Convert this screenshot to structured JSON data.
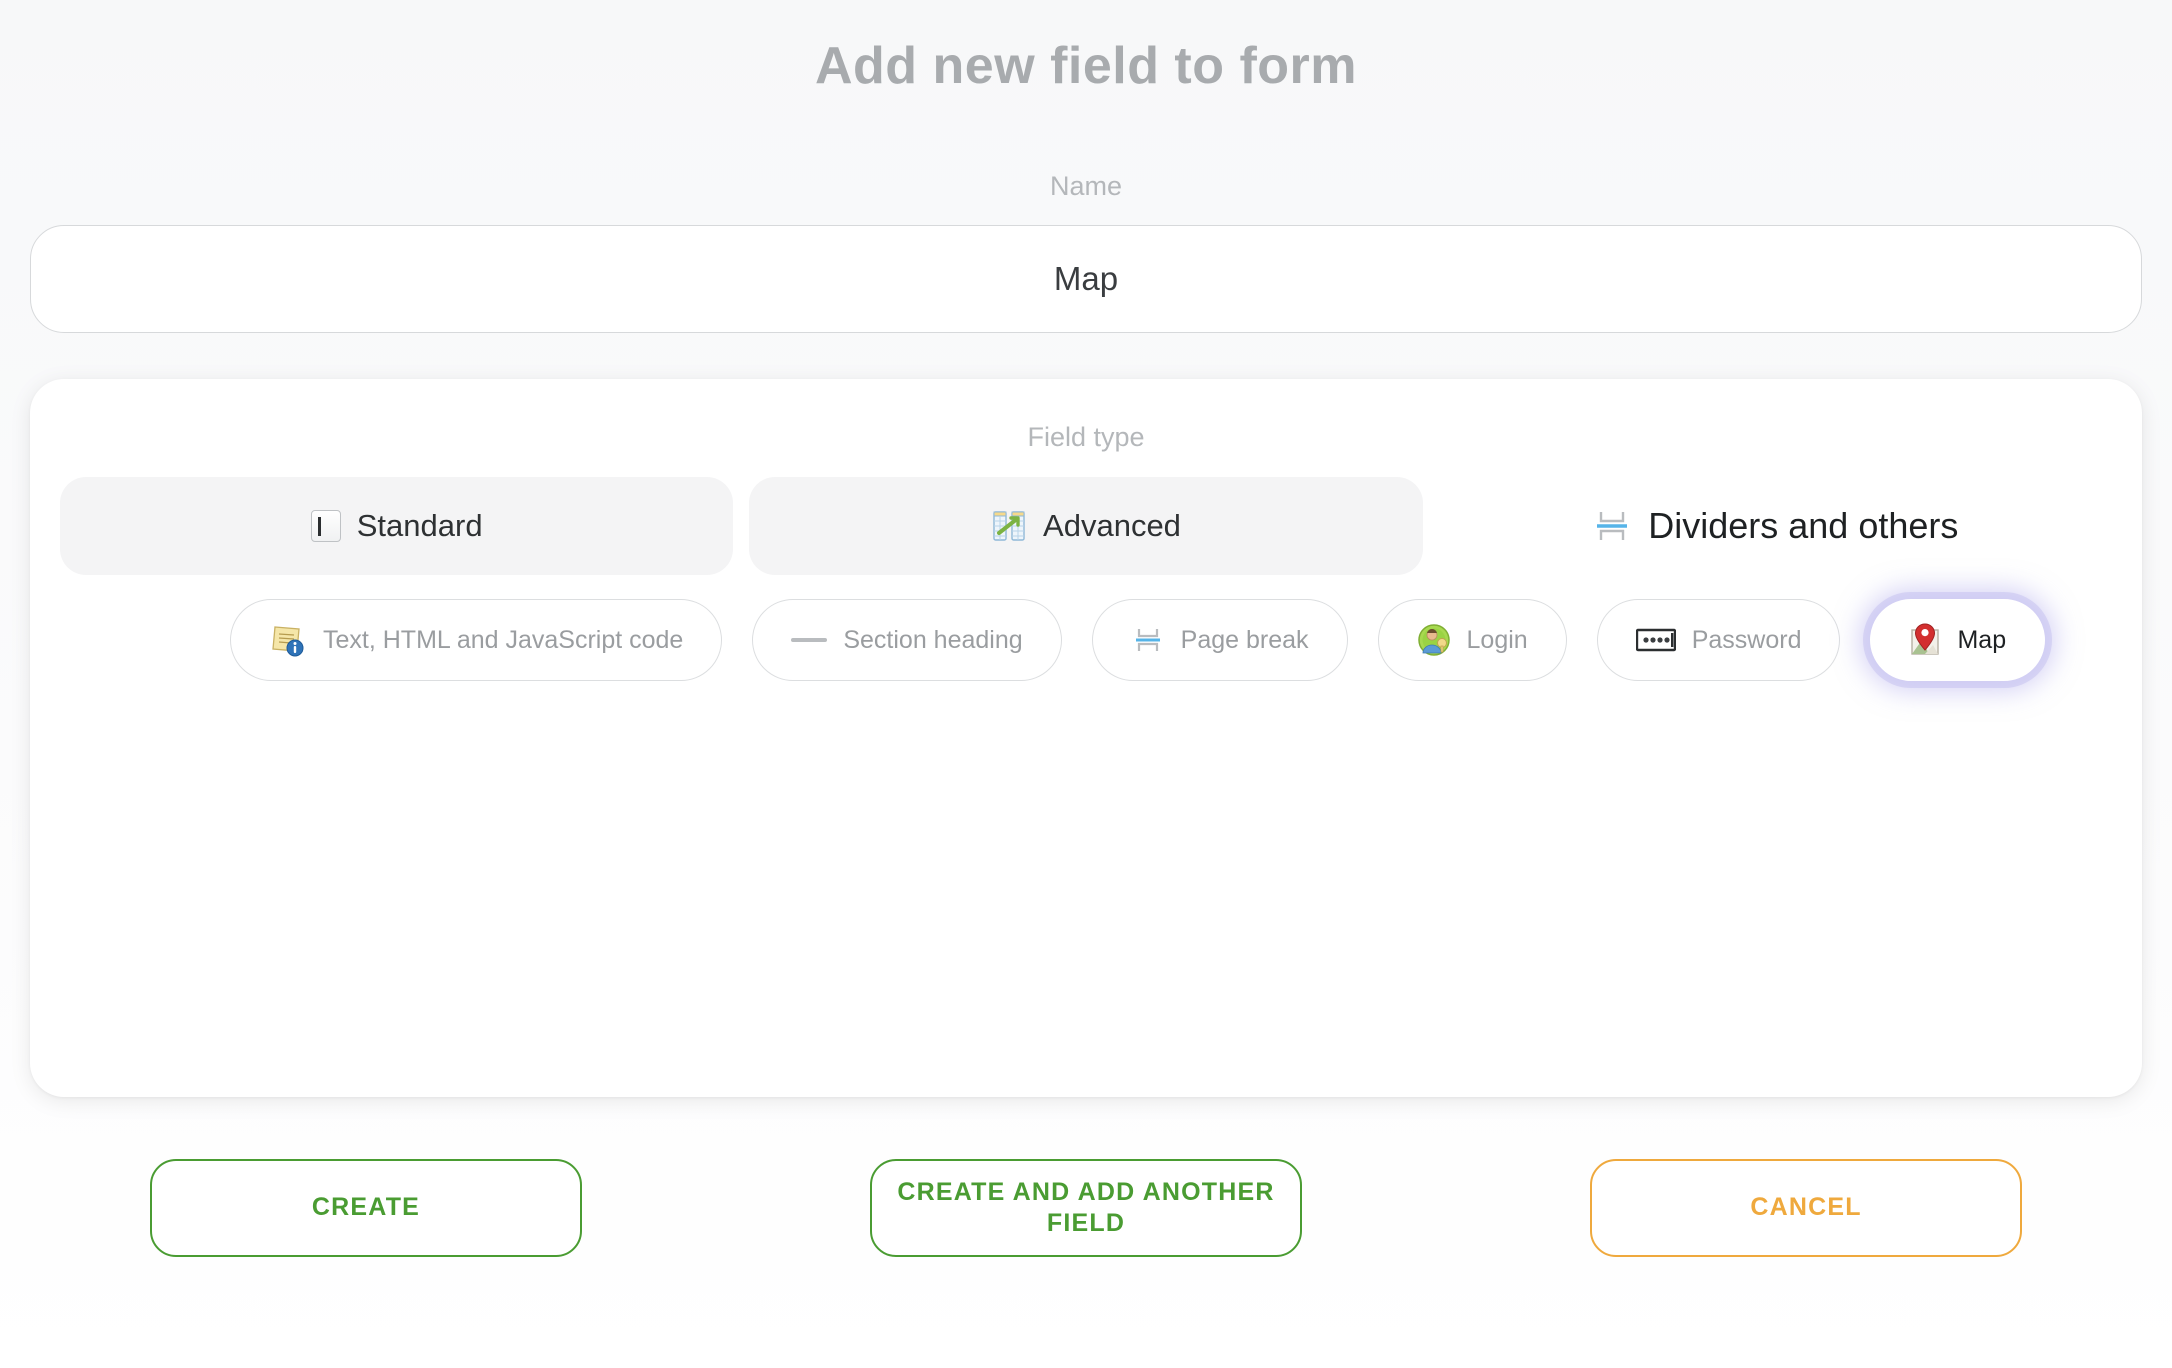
{
  "header": {
    "title": "Add new field to form"
  },
  "name_section": {
    "label": "Name",
    "value": "Map",
    "placeholder": "Name"
  },
  "field_type": {
    "label": "Field type",
    "tabs": [
      {
        "label": "Standard",
        "icon": "text-input-icon",
        "active": false
      },
      {
        "label": "Advanced",
        "icon": "advanced-grid-icon",
        "active": false
      },
      {
        "label": "Dividers and others",
        "icon": "page-break-icon",
        "active": true
      }
    ],
    "options": [
      {
        "label": "Text, HTML and JavaScript code",
        "icon": "note-info-icon",
        "selected": false
      },
      {
        "label": "Section heading",
        "icon": "horizontal-line-icon",
        "selected": false
      },
      {
        "label": "Page break",
        "icon": "page-break-icon",
        "selected": false
      },
      {
        "label": "Login",
        "icon": "user-key-icon",
        "selected": false
      },
      {
        "label": "Password",
        "icon": "password-dots-icon",
        "selected": false
      },
      {
        "label": "Map",
        "icon": "map-pin-icon",
        "selected": true
      }
    ]
  },
  "footer": {
    "create_label": "Create",
    "create_another_label": "Create and add another field",
    "cancel_label": "Cancel"
  },
  "colors": {
    "title_gray": "#a8abae",
    "label_gray": "#b4b7ba",
    "green": "#4a9c32",
    "orange": "#efa93d",
    "selection_glow": "#c7c3f0",
    "tab_inactive_bg": "#f4f4f5",
    "border_gray": "#dcdee0"
  }
}
